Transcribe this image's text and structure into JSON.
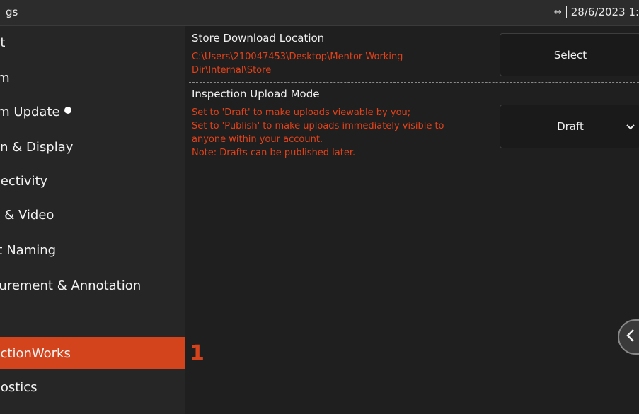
{
  "header": {
    "title": "gs",
    "arrows": "↔",
    "datetime": "28/6/2023 1:"
  },
  "sidebar": {
    "items": [
      {
        "label": "out"
      },
      {
        "label": "tem"
      },
      {
        "label": "tem Update"
      },
      {
        "label": "een & Display"
      },
      {
        "label": "nnectivity"
      },
      {
        "label": "ge & Video"
      },
      {
        "label": "art Naming"
      },
      {
        "label": "asurement & Annotation"
      },
      {
        "label": ""
      },
      {
        "label": "pectionWorks"
      },
      {
        "label": "gnostics"
      }
    ]
  },
  "content": {
    "store": {
      "title": "Store Download Location",
      "path_line1": "C:\\Users\\210047453\\Desktop\\Mentor Working",
      "path_line2": "Dir\\Internal\\Store",
      "button": "Select"
    },
    "upload": {
      "title": "Inspection Upload Mode",
      "desc": [
        "Set to 'Draft' to make uploads viewable by you;",
        "Set to 'Publish' to make uploads immediately visible to",
        "anyone within your account.",
        "Note: Drafts can be published later."
      ],
      "selected": "Draft"
    },
    "marker": "1"
  },
  "colors": {
    "accent": "#d4441c",
    "warning_text": "#e2421a",
    "background": "#1f1f1f",
    "sidebar": "#262626"
  }
}
